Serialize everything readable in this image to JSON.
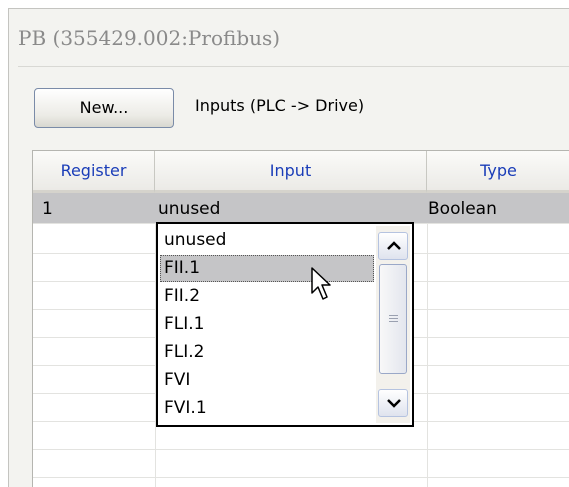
{
  "window": {
    "title": "PB (355429.002:Profibus)"
  },
  "toolbar": {
    "new_button_label": "New...",
    "section_label": "Inputs (PLC -> Drive)"
  },
  "table": {
    "columns": [
      "Register",
      "Input",
      "Type"
    ],
    "rows": [
      {
        "register": "1",
        "input": "unused",
        "type": "Boolean"
      }
    ]
  },
  "dropdown": {
    "items": [
      "unused",
      "FII.1",
      "FII.2",
      "FLI.1",
      "FLI.2",
      "FVI",
      "FVI.1"
    ],
    "highlighted": "FII.1"
  },
  "icons": {
    "scroll_up": "chevron-up-icon",
    "scroll_down": "chevron-down-icon",
    "pointer": "mouse-cursor-icon"
  },
  "colors": {
    "header_text": "#1a3db8",
    "selection": "#c5c5c7"
  }
}
